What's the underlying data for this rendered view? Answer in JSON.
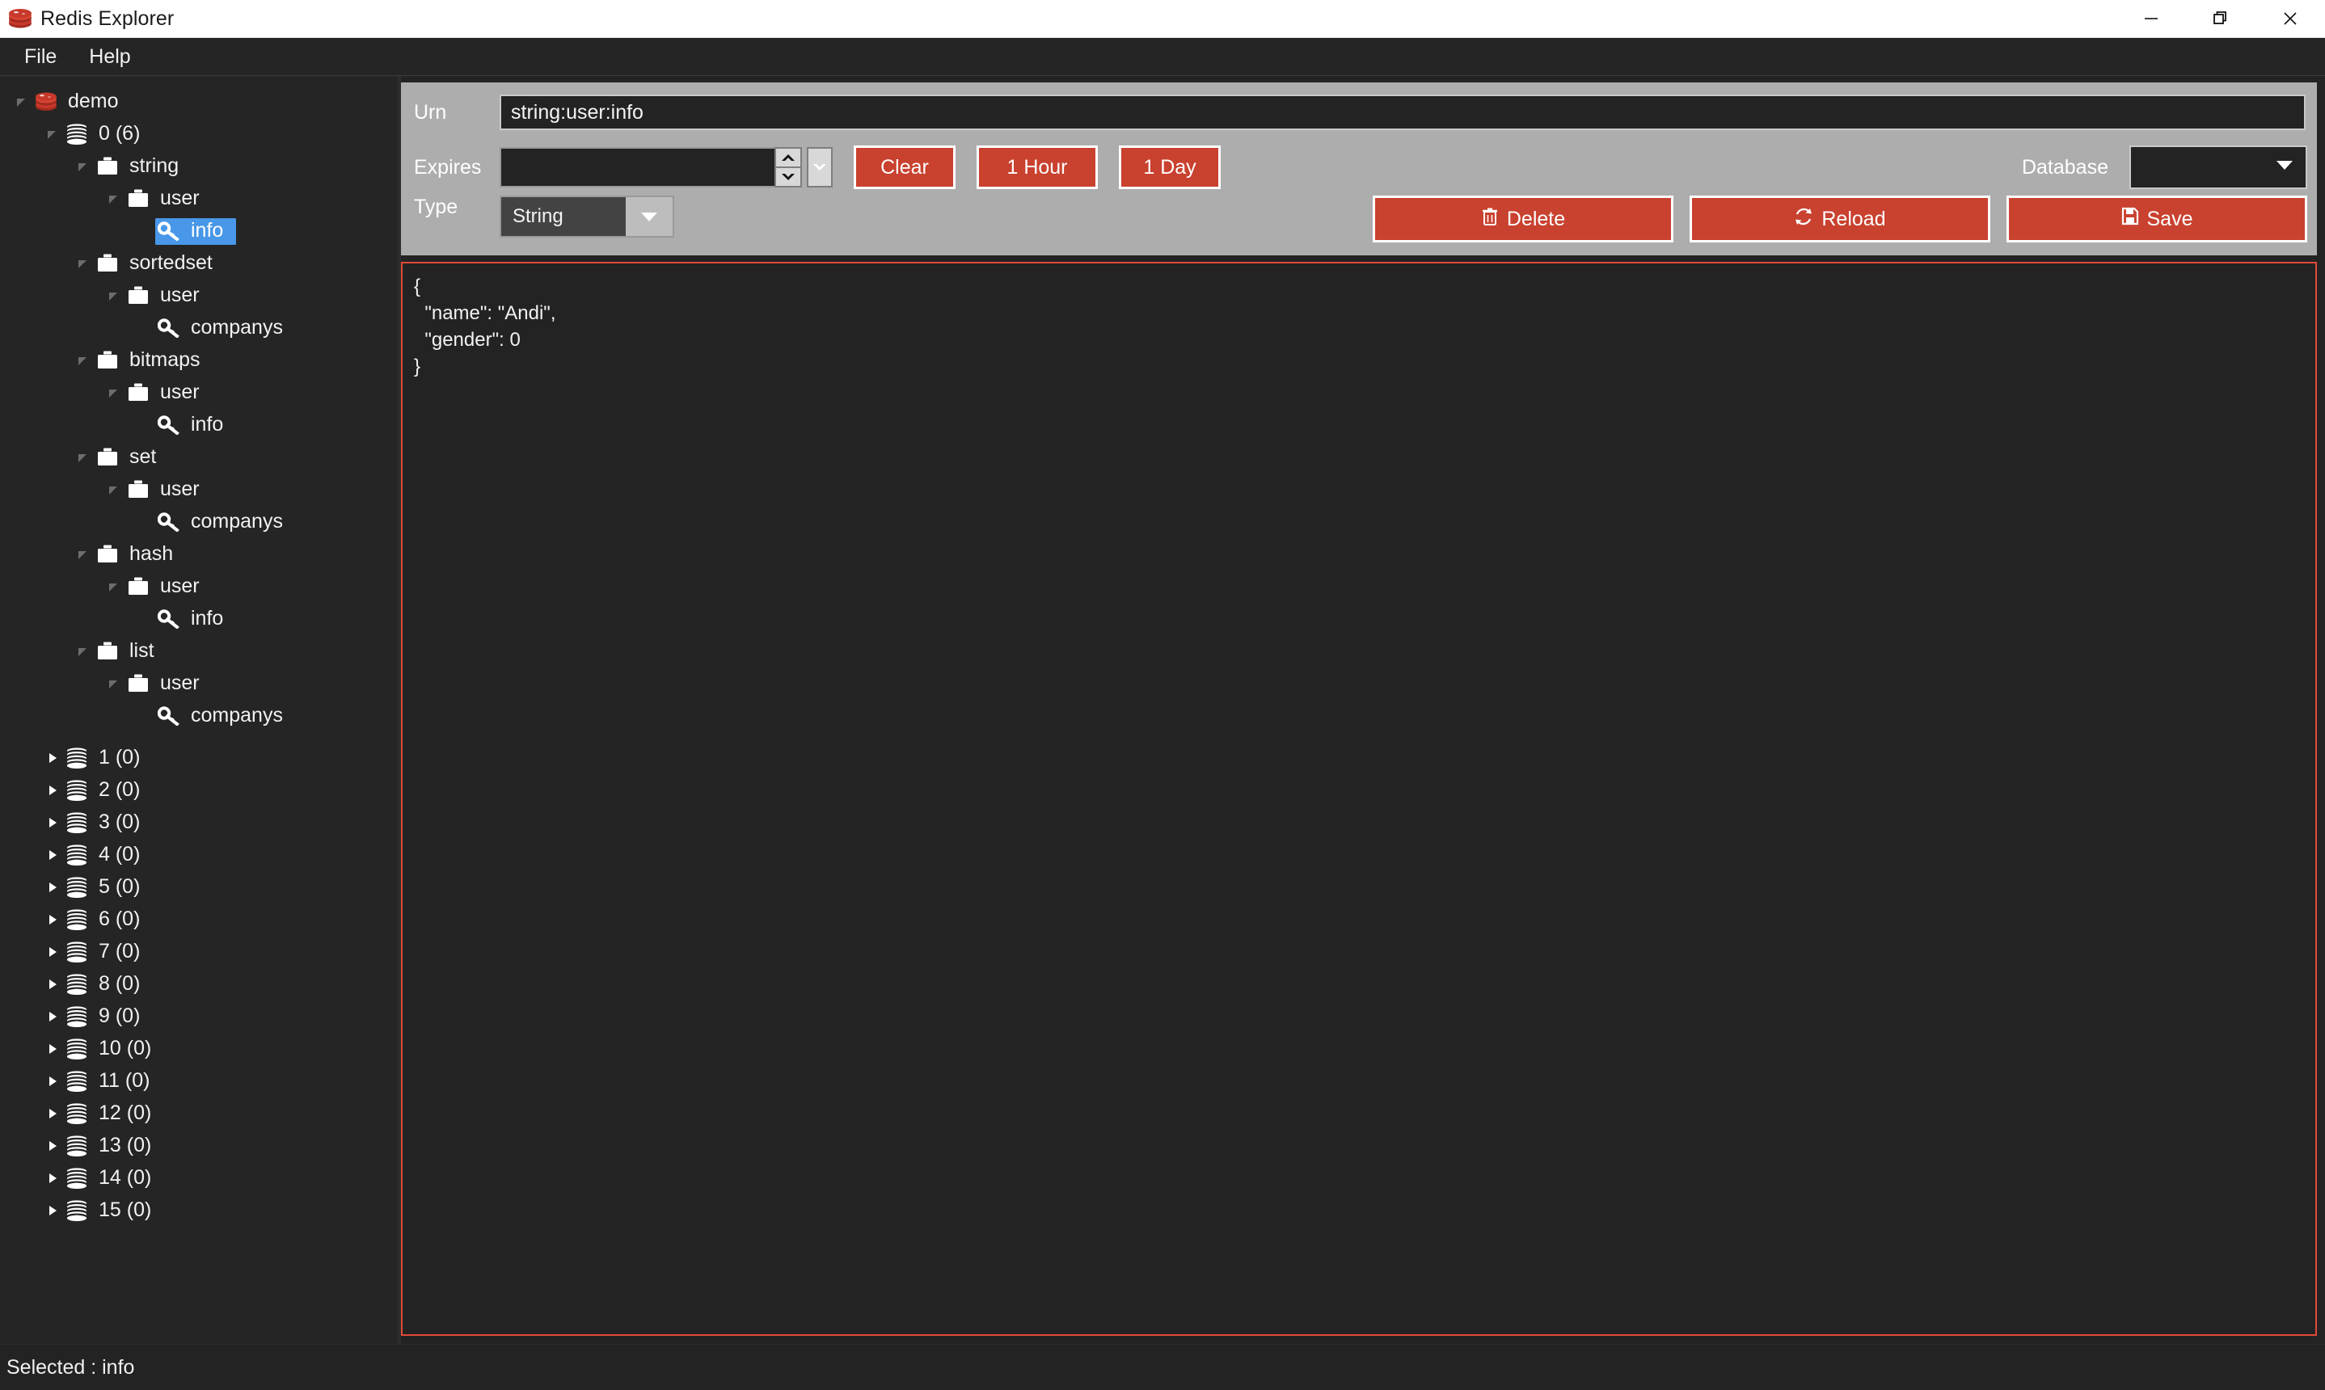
{
  "window": {
    "title": "Redis Explorer",
    "logo_icon": "redis-logo-icon",
    "controls": {
      "minimize": "minimize-icon",
      "maximize": "restore-icon",
      "close": "close-icon"
    }
  },
  "menubar": {
    "items": [
      {
        "label": "File"
      },
      {
        "label": "Help"
      }
    ]
  },
  "tree": {
    "nodes": [
      {
        "label": "demo",
        "depth": 0,
        "icon": "redis-logo-icon",
        "state": "expanded",
        "selected": false
      },
      {
        "label": "0 (6)",
        "depth": 1,
        "icon": "database-icon",
        "state": "expanded",
        "selected": false
      },
      {
        "label": "string",
        "depth": 2,
        "icon": "folder-icon",
        "state": "expanded",
        "selected": false
      },
      {
        "label": "user",
        "depth": 3,
        "icon": "folder-icon",
        "state": "expanded",
        "selected": false
      },
      {
        "label": "info",
        "depth": 4,
        "icon": "key-icon",
        "state": "leaf",
        "selected": true
      },
      {
        "label": "sortedset",
        "depth": 2,
        "icon": "folder-icon",
        "state": "expanded",
        "selected": false
      },
      {
        "label": "user",
        "depth": 3,
        "icon": "folder-icon",
        "state": "expanded",
        "selected": false
      },
      {
        "label": "companys",
        "depth": 4,
        "icon": "key-icon",
        "state": "leaf",
        "selected": false
      },
      {
        "label": "bitmaps",
        "depth": 2,
        "icon": "folder-icon",
        "state": "expanded",
        "selected": false
      },
      {
        "label": "user",
        "depth": 3,
        "icon": "folder-icon",
        "state": "expanded",
        "selected": false
      },
      {
        "label": "info",
        "depth": 4,
        "icon": "key-icon",
        "state": "leaf",
        "selected": false
      },
      {
        "label": "set",
        "depth": 2,
        "icon": "folder-icon",
        "state": "expanded",
        "selected": false
      },
      {
        "label": "user",
        "depth": 3,
        "icon": "folder-icon",
        "state": "expanded",
        "selected": false
      },
      {
        "label": "companys",
        "depth": 4,
        "icon": "key-icon",
        "state": "leaf",
        "selected": false
      },
      {
        "label": "hash",
        "depth": 2,
        "icon": "folder-icon",
        "state": "expanded",
        "selected": false
      },
      {
        "label": "user",
        "depth": 3,
        "icon": "folder-icon",
        "state": "expanded",
        "selected": false
      },
      {
        "label": "info",
        "depth": 4,
        "icon": "key-icon",
        "state": "leaf",
        "selected": false
      },
      {
        "label": "list",
        "depth": 2,
        "icon": "folder-icon",
        "state": "expanded",
        "selected": false
      },
      {
        "label": "user",
        "depth": 3,
        "icon": "folder-icon",
        "state": "expanded",
        "selected": false
      },
      {
        "label": "companys",
        "depth": 4,
        "icon": "key-icon",
        "state": "leaf",
        "selected": false
      },
      {
        "label": "1 (0)",
        "depth": 1,
        "icon": "database-icon",
        "state": "collapsed",
        "selected": false,
        "gap_above": true
      },
      {
        "label": "2 (0)",
        "depth": 1,
        "icon": "database-icon",
        "state": "collapsed",
        "selected": false
      },
      {
        "label": "3 (0)",
        "depth": 1,
        "icon": "database-icon",
        "state": "collapsed",
        "selected": false
      },
      {
        "label": "4 (0)",
        "depth": 1,
        "icon": "database-icon",
        "state": "collapsed",
        "selected": false
      },
      {
        "label": "5 (0)",
        "depth": 1,
        "icon": "database-icon",
        "state": "collapsed",
        "selected": false
      },
      {
        "label": "6 (0)",
        "depth": 1,
        "icon": "database-icon",
        "state": "collapsed",
        "selected": false
      },
      {
        "label": "7 (0)",
        "depth": 1,
        "icon": "database-icon",
        "state": "collapsed",
        "selected": false
      },
      {
        "label": "8 (0)",
        "depth": 1,
        "icon": "database-icon",
        "state": "collapsed",
        "selected": false
      },
      {
        "label": "9 (0)",
        "depth": 1,
        "icon": "database-icon",
        "state": "collapsed",
        "selected": false
      },
      {
        "label": "10 (0)",
        "depth": 1,
        "icon": "database-icon",
        "state": "collapsed",
        "selected": false
      },
      {
        "label": "11 (0)",
        "depth": 1,
        "icon": "database-icon",
        "state": "collapsed",
        "selected": false
      },
      {
        "label": "12 (0)",
        "depth": 1,
        "icon": "database-icon",
        "state": "collapsed",
        "selected": false
      },
      {
        "label": "13 (0)",
        "depth": 1,
        "icon": "database-icon",
        "state": "collapsed",
        "selected": false
      },
      {
        "label": "14 (0)",
        "depth": 1,
        "icon": "database-icon",
        "state": "collapsed",
        "selected": false
      },
      {
        "label": "15 (0)",
        "depth": 1,
        "icon": "database-icon",
        "state": "collapsed",
        "selected": false
      }
    ]
  },
  "form": {
    "urn": {
      "label": "Urn",
      "value": "string:user:info",
      "placeholder": ""
    },
    "expires": {
      "label": "Expires",
      "value": "",
      "placeholder": "",
      "spinner_up_icon": "spinner-up-icon",
      "spinner_down_icon": "spinner-down-icon",
      "dropdown_icon": "chevron-down-icon"
    },
    "buttons": {
      "clear": "Clear",
      "one_hour": "1 Hour",
      "one_day": "1 Day"
    },
    "type": {
      "label": "Type",
      "value": "String",
      "dropdown_icon": "chevron-down-icon"
    },
    "database": {
      "label": "Database",
      "value": "",
      "dropdown_icon": "chevron-down-icon"
    },
    "actions": {
      "delete": {
        "label": "Delete",
        "icon": "trash-icon"
      },
      "reload": {
        "label": "Reload",
        "icon": "refresh-icon"
      },
      "save": {
        "label": "Save",
        "icon": "save-icon"
      }
    }
  },
  "editor": {
    "content": "{\n  \"name\": \"Andi\",\n  \"gender\": 0\n}"
  },
  "statusbar": {
    "text": "Selected : info"
  },
  "colors": {
    "accent_red": "#c9412f",
    "editor_border": "#e04a37",
    "panel_gray": "#adadad",
    "selection_blue": "#4897e8",
    "window_dark": "#232323",
    "tree_bg": "#252525"
  }
}
